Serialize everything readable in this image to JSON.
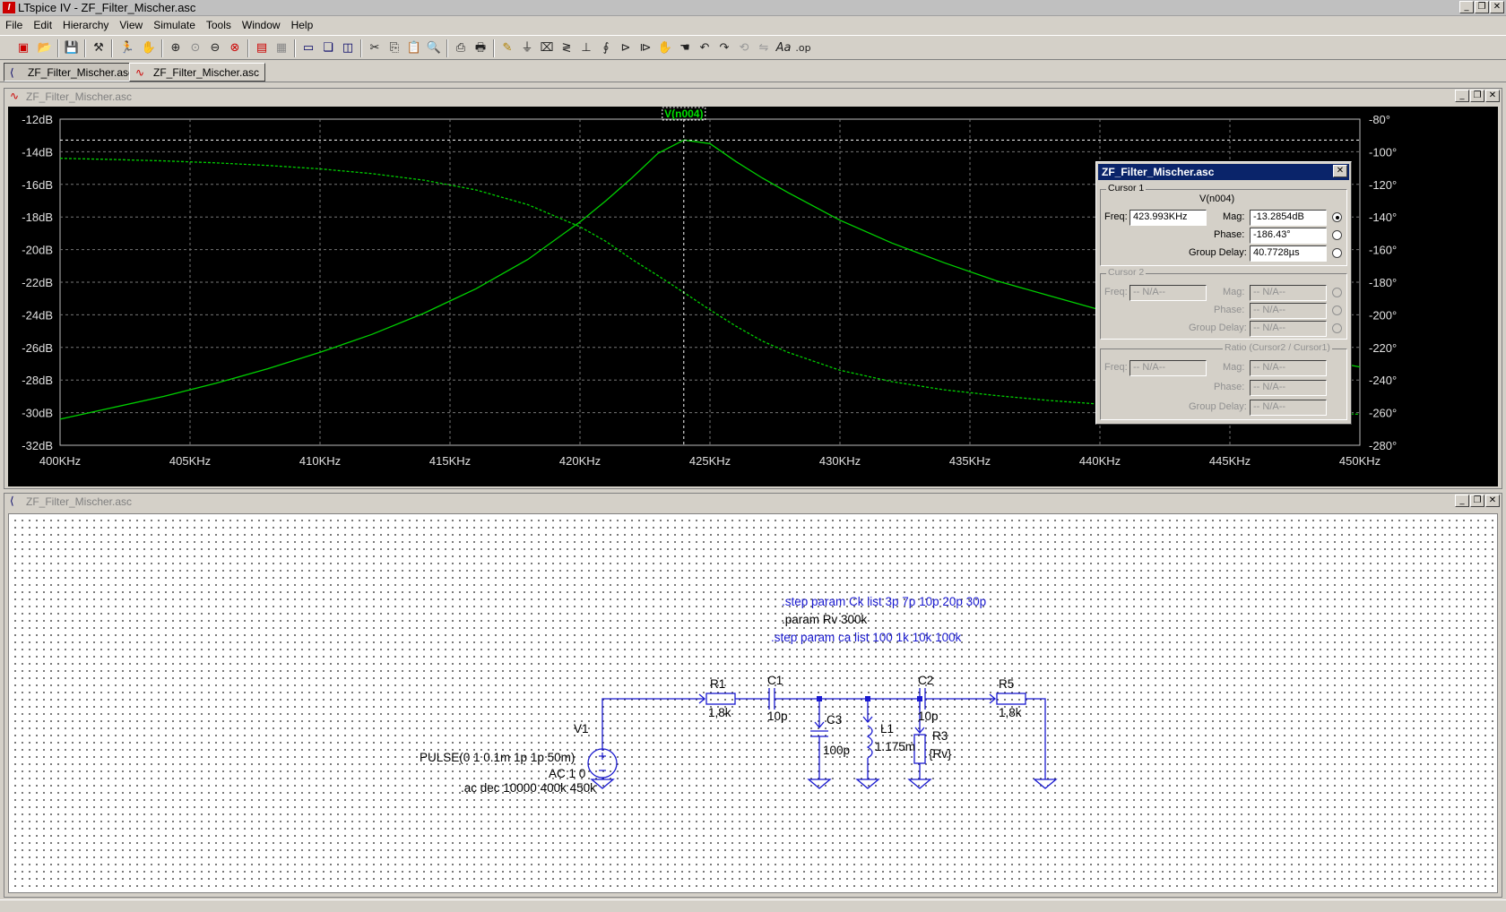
{
  "app": {
    "title": "LTspice IV - ZF_Filter_Mischer.asc"
  },
  "menu": [
    "File",
    "Edit",
    "Hierarchy",
    "View",
    "Simulate",
    "Tools",
    "Window",
    "Help"
  ],
  "tabs": [
    {
      "label": "ZF_Filter_Mischer.asc",
      "icon": "schematic-icon",
      "active": true
    },
    {
      "label": "ZF_Filter_Mischer.asc",
      "icon": "waveform-icon",
      "active": false
    }
  ],
  "plot_pane": {
    "title": "ZF_Filter_Mischer.asc"
  },
  "schematic_pane": {
    "title": "ZF_Filter_Mischer.asc"
  },
  "chart_data": {
    "type": "line",
    "trace_label": "V(n004)",
    "x": {
      "min": 400,
      "max": 450,
      "unit": "KHz",
      "ticks": [
        "400KHz",
        "405KHz",
        "410KHz",
        "415KHz",
        "420KHz",
        "425KHz",
        "430KHz",
        "435KHz",
        "440KHz",
        "445KHz",
        "450KHz"
      ]
    },
    "y_left": {
      "min": -32,
      "max": -12,
      "unit": "dB",
      "ticks": [
        "-12dB",
        "-14dB",
        "-16dB",
        "-18dB",
        "-20dB",
        "-22dB",
        "-24dB",
        "-26dB",
        "-28dB",
        "-30dB",
        "-32dB"
      ]
    },
    "y_right": {
      "min": -280,
      "max": -80,
      "unit": "°",
      "ticks": [
        "-80°",
        "-100°",
        "-120°",
        "-140°",
        "-160°",
        "-180°",
        "-200°",
        "-220°",
        "-240°",
        "-260°",
        "-280°"
      ]
    },
    "grid": true,
    "cursor": {
      "x": 423.993,
      "y": -13.2854
    },
    "series": [
      {
        "kind": "magnitude",
        "color": "#00d000",
        "points": [
          [
            400,
            -30.4
          ],
          [
            402,
            -29.7
          ],
          [
            404,
            -29.0
          ],
          [
            406,
            -28.2
          ],
          [
            408,
            -27.3
          ],
          [
            410,
            -26.3
          ],
          [
            412,
            -25.2
          ],
          [
            414,
            -23.9
          ],
          [
            416,
            -22.4
          ],
          [
            418,
            -20.6
          ],
          [
            420,
            -18.3
          ],
          [
            421,
            -17.0
          ],
          [
            422,
            -15.6
          ],
          [
            423,
            -14.1
          ],
          [
            424,
            -13.28
          ],
          [
            425,
            -13.5
          ],
          [
            426,
            -14.6
          ],
          [
            427,
            -15.6
          ],
          [
            428,
            -16.5
          ],
          [
            430,
            -18.2
          ],
          [
            432,
            -19.6
          ],
          [
            434,
            -20.8
          ],
          [
            436,
            -21.9
          ],
          [
            438,
            -22.8
          ],
          [
            440,
            -23.7
          ],
          [
            442,
            -24.5
          ],
          [
            444,
            -25.2
          ],
          [
            446,
            -25.9
          ],
          [
            448,
            -26.6
          ],
          [
            450,
            -27.2
          ]
        ]
      },
      {
        "kind": "phase",
        "color": "#00d000",
        "dashed": true,
        "points": [
          [
            400,
            -104
          ],
          [
            402,
            -104.7
          ],
          [
            404,
            -105.6
          ],
          [
            406,
            -106.8
          ],
          [
            408,
            -108.4
          ],
          [
            410,
            -110.5
          ],
          [
            412,
            -113.4
          ],
          [
            414,
            -117.4
          ],
          [
            416,
            -123.4
          ],
          [
            418,
            -132.5
          ],
          [
            420,
            -146.0
          ],
          [
            421,
            -155.0
          ],
          [
            422,
            -166.0
          ],
          [
            423,
            -176.0
          ],
          [
            424,
            -186.4
          ],
          [
            425,
            -197.0
          ],
          [
            426,
            -207.0
          ],
          [
            427,
            -216.0
          ],
          [
            428,
            -223.0
          ],
          [
            430,
            -234.0
          ],
          [
            432,
            -241.0
          ],
          [
            434,
            -246.0
          ],
          [
            436,
            -249.5
          ],
          [
            438,
            -252.5
          ],
          [
            440,
            -254.8
          ],
          [
            442,
            -256.5
          ],
          [
            444,
            -258.0
          ],
          [
            446,
            -259.2
          ],
          [
            448,
            -260.2
          ],
          [
            450,
            -261.0
          ]
        ]
      }
    ]
  },
  "cursor_dialog": {
    "title": "ZF_Filter_Mischer.asc",
    "cursor1": {
      "group": "Cursor 1",
      "trace": "V(n004)",
      "freq_label": "Freq:",
      "freq": "423.993KHz",
      "mag_label": "Mag:",
      "mag": "-13.2854dB",
      "phase_label": "Phase:",
      "phase": "-186.43°",
      "gd_label": "Group Delay:",
      "gd": "40.7728µs"
    },
    "cursor2": {
      "group": "Cursor 2",
      "freq_label": "Freq:",
      "freq": "-- N/A--",
      "mag_label": "Mag:",
      "mag": "-- N/A--",
      "phase_label": "Phase:",
      "phase": "-- N/A--",
      "gd_label": "Group Delay:",
      "gd": "-- N/A--"
    },
    "ratio": {
      "group": "Ratio (Cursor2 / Cursor1)",
      "freq_label": "Freq:",
      "freq": "-- N/A--",
      "mag_label": "Mag:",
      "mag": "-- N/A--",
      "phase_label": "Phase:",
      "phase": "-- N/A--",
      "gd_label": "Group Delay:",
      "gd": "-- N/A--"
    }
  },
  "schematic": {
    "directives": [
      ".step param Ck list 3p 7p 10p 20p 30p",
      ".param Rv 300k",
      ".step param ca list 100 1k 10k 100k"
    ],
    "components": {
      "r1_name": "R1",
      "r1_value": "1,8k",
      "c1_name": "C1",
      "c1_value": "10p",
      "c3_name": "C3",
      "c3_value": "100p",
      "l1_name": "L1",
      "l1_value": "1.175m",
      "r3_name": "R3",
      "r3_value": "{Rv}",
      "c2_name": "C2",
      "c2_value": "10p",
      "r5_name": "R5",
      "r5_value": "1,8k",
      "v1_name": "V1",
      "v1_pulse": "PULSE(0 1 0.1m 1p 1p 50m)",
      "v1_ac": "AC 1 0",
      "ac_directive": ".ac dec 10000 400k 450k"
    }
  }
}
